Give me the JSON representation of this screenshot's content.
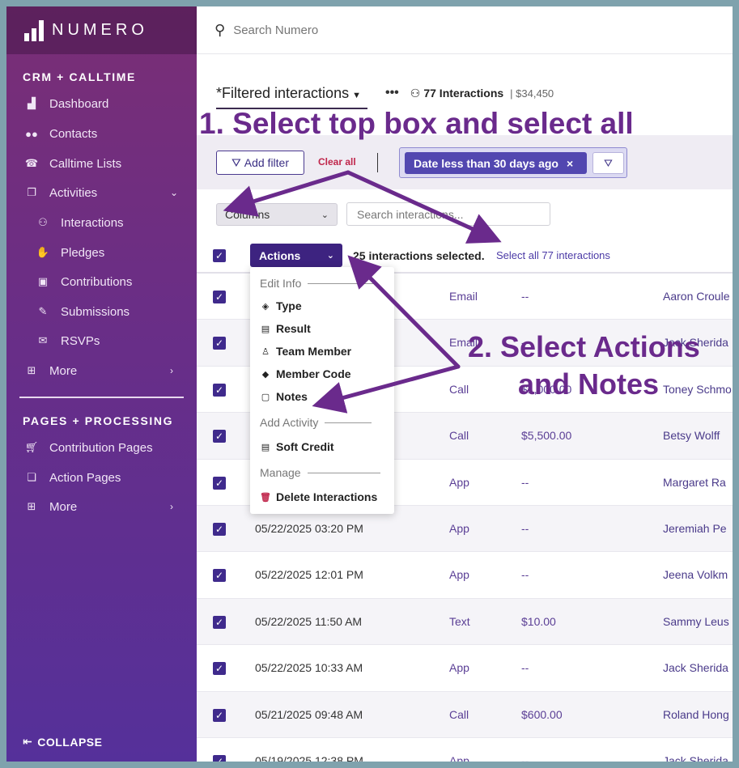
{
  "brand": {
    "name": "NUMERO"
  },
  "sidebar": {
    "section1": "CRM + CALLTIME",
    "items1": [
      {
        "label": "Dashboard",
        "icon": "dashboard-icon"
      },
      {
        "label": "Contacts",
        "icon": "contacts-icon"
      },
      {
        "label": "Calltime Lists",
        "icon": "calltime-icon"
      },
      {
        "label": "Activities",
        "icon": "activities-icon"
      }
    ],
    "subitems": [
      {
        "label": "Interactions",
        "icon": "interactions-icon"
      },
      {
        "label": "Pledges",
        "icon": "handshake-icon"
      },
      {
        "label": "Contributions",
        "icon": "contributions-icon"
      },
      {
        "label": "Submissions",
        "icon": "submissions-icon"
      },
      {
        "label": "RSVPs",
        "icon": "rsvp-icon"
      }
    ],
    "more1": "More",
    "section2": "PAGES + PROCESSING",
    "items2": [
      {
        "label": "Contribution Pages",
        "icon": "cart-icon"
      },
      {
        "label": "Action Pages",
        "icon": "action-pages-icon"
      }
    ],
    "more2": "More",
    "collapse": "COLLAPSE"
  },
  "search": {
    "placeholder": "Search Numero"
  },
  "view": {
    "title": "*Filtered interactions",
    "dots": "•••",
    "count": "77 Interactions",
    "amount": "| $34,450"
  },
  "filters": {
    "add_filter": "Add filter",
    "clear_all": "Clear all",
    "chip": "Date less than 30 days ago",
    "chip_close": "×"
  },
  "table_controls": {
    "columns": "Columns",
    "search_placeholder": "Search interactions..."
  },
  "selection": {
    "actions": "Actions",
    "selected_text": "25 interactions selected.",
    "select_all": "Select all 77 interactions"
  },
  "rows": [
    {
      "date": "",
      "type": "Email",
      "amount": "--",
      "name": "Aaron Croule"
    },
    {
      "date": "",
      "type": "Email",
      "amount": "--",
      "name": "Jack Sherida"
    },
    {
      "date": "",
      "type": "Call",
      "amount": "$1,000.00",
      "name": "Toney Schmo"
    },
    {
      "date": "",
      "type": "Call",
      "amount": "$5,500.00",
      "name": "Betsy Wolff"
    },
    {
      "date": "",
      "type": "App",
      "amount": "--",
      "name": "Margaret Ra"
    },
    {
      "date": "05/22/2025 03:20 PM",
      "type": "App",
      "amount": "--",
      "name": "Jeremiah Pe"
    },
    {
      "date": "05/22/2025 12:01 PM",
      "type": "App",
      "amount": "--",
      "name": "Jeena Volkm"
    },
    {
      "date": "05/22/2025 11:50 AM",
      "type": "Text",
      "amount": "$10.00",
      "name": "Sammy Leus"
    },
    {
      "date": "05/22/2025 10:33 AM",
      "type": "App",
      "amount": "--",
      "name": "Jack Sherida"
    },
    {
      "date": "05/21/2025 09:48 AM",
      "type": "Call",
      "amount": "$600.00",
      "name": "Roland Hong"
    },
    {
      "date": "05/19/2025 12:38 PM",
      "type": "App",
      "amount": "--",
      "name": "Jack Sherida"
    }
  ],
  "menu": {
    "group1": "Edit Info",
    "items1": [
      {
        "label": "Type",
        "icon": "layers-icon"
      },
      {
        "label": "Result",
        "icon": "result-icon"
      },
      {
        "label": "Team Member",
        "icon": "team-icon"
      },
      {
        "label": "Member Code",
        "icon": "tag-icon"
      },
      {
        "label": "Notes",
        "icon": "note-icon"
      }
    ],
    "group2": "Add Activity",
    "items2": [
      {
        "label": "Soft Credit",
        "icon": "list-icon"
      }
    ],
    "group3": "Manage",
    "items3": [
      {
        "label": "Delete Interactions",
        "icon": "trash-icon"
      }
    ]
  },
  "annotations": {
    "step1": "1. Select top box and select all",
    "step2_line1": "2. Select Actions",
    "step2_line2": "and Notes"
  },
  "colors": {
    "accent": "#3d2380",
    "annotation": "#6a2a8c",
    "danger": "#c0264b"
  }
}
